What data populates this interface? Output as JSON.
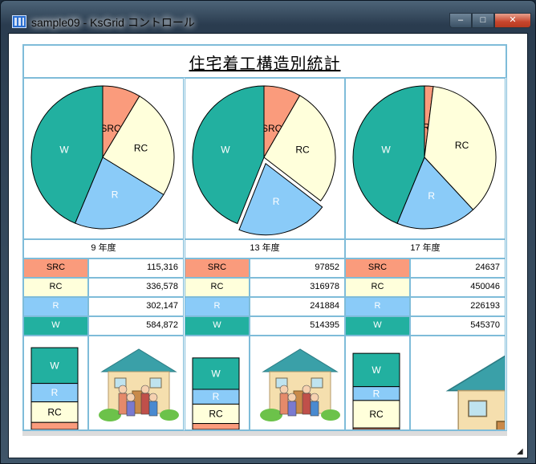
{
  "window": {
    "title_prefix": "sample09 - ",
    "title_app": "KsGrid コントロール"
  },
  "caption": {
    "minimize": "–",
    "maximize": "□",
    "close": "✕"
  },
  "grid": {
    "title": "住宅着工構造別統計",
    "categories": [
      "SRC",
      "RC",
      "R",
      "W"
    ],
    "category_colors": {
      "SRC": "#fa9b7c",
      "RC": "#ffffdb",
      "R": "#8acbf8",
      "W": "#22b0a0"
    },
    "years": [
      {
        "label": "9 年度",
        "values": [
          115316,
          336578,
          302147,
          584872
        ],
        "display": [
          "115,316",
          "336,578",
          "302,147",
          "584,872"
        ],
        "exploded": null
      },
      {
        "label": "13 年度",
        "values": [
          97852,
          316978,
          241884,
          514395
        ],
        "display": [
          "97852",
          "316978",
          "241884",
          "514395"
        ],
        "exploded": "R"
      },
      {
        "label": "17 年度",
        "values": [
          24637,
          450046,
          226193,
          545370
        ],
        "display": [
          "24637",
          "450046",
          "226193",
          "545370"
        ],
        "exploded": null
      }
    ]
  },
  "chart_data": [
    {
      "type": "pie",
      "title": "9 年度",
      "labels": [
        "SRC",
        "RC",
        "R",
        "W"
      ],
      "values": [
        115316,
        336578,
        302147,
        584872
      ]
    },
    {
      "type": "pie",
      "title": "13 年度",
      "labels": [
        "SRC",
        "RC",
        "R",
        "W"
      ],
      "values": [
        97852,
        316978,
        241884,
        514395
      ]
    },
    {
      "type": "pie",
      "title": "17 年度",
      "labels": [
        "SRC",
        "RC",
        "R",
        "W"
      ],
      "values": [
        24637,
        450046,
        226193,
        545370
      ]
    },
    {
      "type": "bar",
      "title": "",
      "categories": [
        "SRC",
        "RC",
        "R",
        "W"
      ],
      "values": [
        115316,
        336578,
        302147,
        584872
      ]
    },
    {
      "type": "bar",
      "title": "",
      "categories": [
        "SRC",
        "RC",
        "R",
        "W"
      ],
      "values": [
        97852,
        316978,
        241884,
        514395
      ]
    },
    {
      "type": "bar",
      "title": "",
      "categories": [
        "SRC",
        "RC",
        "R",
        "W"
      ],
      "values": [
        24637,
        450046,
        226193,
        545370
      ]
    }
  ]
}
